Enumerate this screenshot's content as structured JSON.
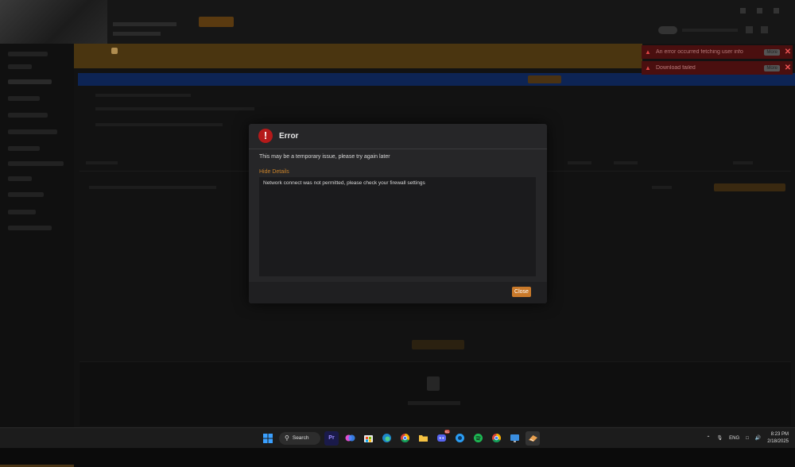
{
  "toasts": [
    {
      "message": "An error occurred fetching user info",
      "more_label": "More"
    },
    {
      "message": "Download failed",
      "more_label": "More"
    }
  ],
  "dialog": {
    "title": "Error",
    "message": "This may be a temporary issue, please try again later",
    "details_toggle": "Hide Details",
    "details_text": "Network connect was not permitted, please check your firewall settings",
    "close_label": "Close"
  },
  "taskbar": {
    "search_label": "Search",
    "discord_badge": "61",
    "tray_lang": "ENG",
    "time": "8:23 PM",
    "date": "2/18/2025"
  },
  "colors": {
    "accent": "#c9792a",
    "error": "#b51a1a",
    "dialog_bg": "#262628"
  }
}
